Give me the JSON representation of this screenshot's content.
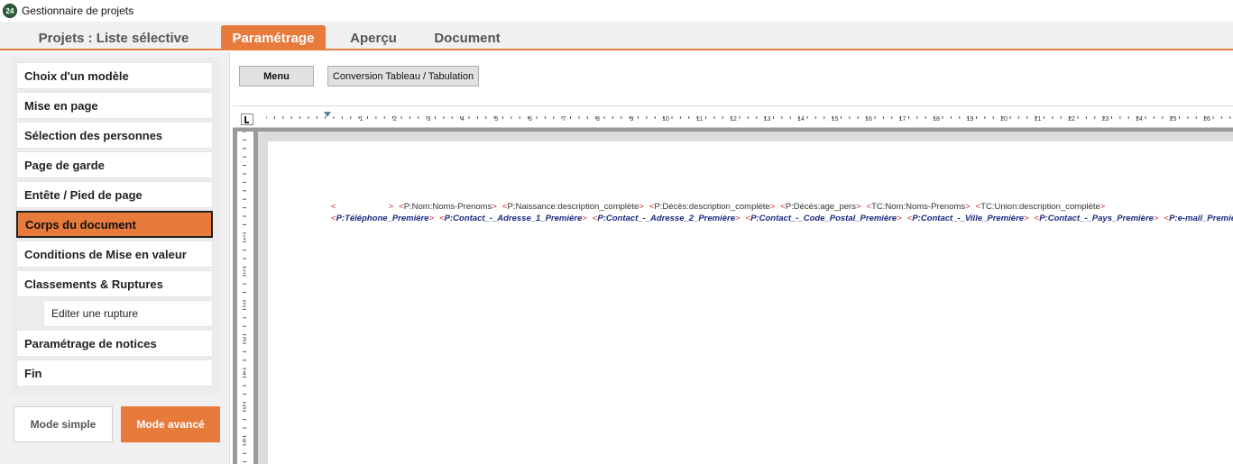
{
  "window": {
    "title": "Gestionnaire de projets",
    "icon_text": "24"
  },
  "tabs": [
    {
      "label": "Projets : Liste sélective",
      "active": false
    },
    {
      "label": "Paramétrage",
      "active": true
    },
    {
      "label": "Aperçu",
      "active": false
    },
    {
      "label": "Document",
      "active": false
    }
  ],
  "sidebar": {
    "items": [
      {
        "label": "Choix d'un modèle",
        "active": false
      },
      {
        "label": "Mise en page",
        "active": false
      },
      {
        "label": "Sélection des personnes",
        "active": false
      },
      {
        "label": "Page de garde",
        "active": false
      },
      {
        "label": "Entête / Pied de page",
        "active": false
      },
      {
        "label": "Corps du document",
        "active": true
      },
      {
        "label": "Conditions de Mise en valeur",
        "active": false
      },
      {
        "label": "Classements & Ruptures",
        "active": false
      },
      {
        "label": "Editer une rupture",
        "active": false
      },
      {
        "label": "Paramétrage de notices",
        "active": false
      },
      {
        "label": "Fin",
        "active": false
      }
    ]
  },
  "mode_buttons": {
    "simple": "Mode simple",
    "avance": "Mode avancé"
  },
  "toolbar": {
    "menu_label": "Menu",
    "conversion_label": "Conversion Tableau / Tabulation"
  },
  "ruler": {
    "top_numbers": [
      "1",
      "2",
      "3",
      "4",
      "5",
      "6",
      "7",
      "8",
      "9",
      "10",
      "11",
      "12",
      "13",
      "14",
      "15",
      "16",
      "17",
      "18",
      "19",
      "20",
      "21",
      "22",
      "23",
      "24",
      "25",
      "26"
    ],
    "left_numbers": [
      "1",
      "1",
      "2",
      "3",
      "4",
      "5",
      "6"
    ]
  },
  "document": {
    "line1": [
      {
        "lt": "<",
        "code": "",
        "gt": ">"
      },
      {
        "lt": "<",
        "code": "P:Nom:Noms-Prenoms",
        "gt": ">"
      },
      {
        "lt": "<",
        "code": "P:Naissance:description_complète",
        "gt": ">"
      },
      {
        "lt": "<",
        "code": "P:Décès:description_complète",
        "gt": ">"
      },
      {
        "lt": "<",
        "code": "P:Décès:age_pers",
        "gt": ">"
      },
      {
        "lt": "<",
        "code": "TC:Nom:Noms-Prenoms",
        "gt": ">"
      },
      {
        "lt": "<",
        "code": "TC:Union:description_complète",
        "gt": ">"
      }
    ],
    "line2": [
      {
        "lt": "<",
        "code": "P:Téléphone_Première",
        "gt": ">"
      },
      {
        "lt": "<",
        "code": "P:Contact_-_Adresse_1_Première",
        "gt": ">"
      },
      {
        "lt": "<",
        "code": "P:Contact_-_Adresse_2_Première",
        "gt": ">"
      },
      {
        "lt": "<",
        "code": "P:Contact_-_Code_Postal_Première",
        "gt": ">"
      },
      {
        "lt": "<",
        "code": "P:Contact_-_Ville_Première",
        "gt": ">"
      },
      {
        "lt": "<",
        "code": "P:Contact_-_Pays_Première",
        "gt": ">"
      },
      {
        "lt": "<",
        "code": "P:e-mail_Première",
        "gt": ">"
      }
    ]
  },
  "colors": {
    "accent": "#e87a3c",
    "field_delimiter": "#d21f1f",
    "field_text_line2": "#1b2b80"
  }
}
